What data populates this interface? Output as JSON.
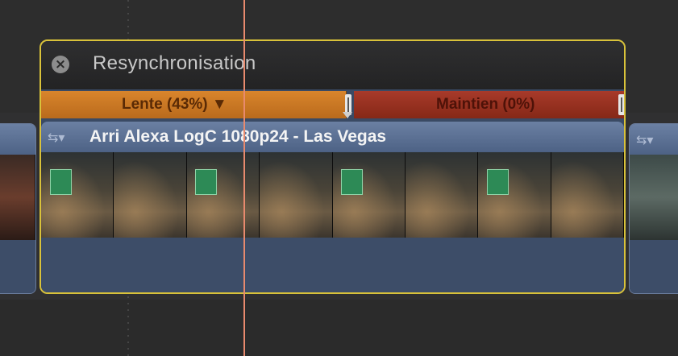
{
  "retime": {
    "close_icon": "close-icon",
    "title": "Resynchronisation",
    "segments": [
      {
        "label": "Lente (43%) ▼",
        "speed_percent": 43,
        "color": "#d9852c"
      },
      {
        "label": "Maintien (0%)",
        "speed_percent": 0,
        "color": "#a83a2a"
      }
    ]
  },
  "clips": {
    "main": {
      "icon": "retime-clip-icon",
      "title": "Arri Alexa LogC 1080p24 - Las Vegas",
      "frames": 8
    },
    "left": {
      "icon": "clip-icon"
    },
    "right": {
      "icon": "clip-icon"
    }
  },
  "colors": {
    "selection_border": "#d9c23a",
    "playhead": "#e88a6e",
    "clip_header": "#5b7095"
  }
}
